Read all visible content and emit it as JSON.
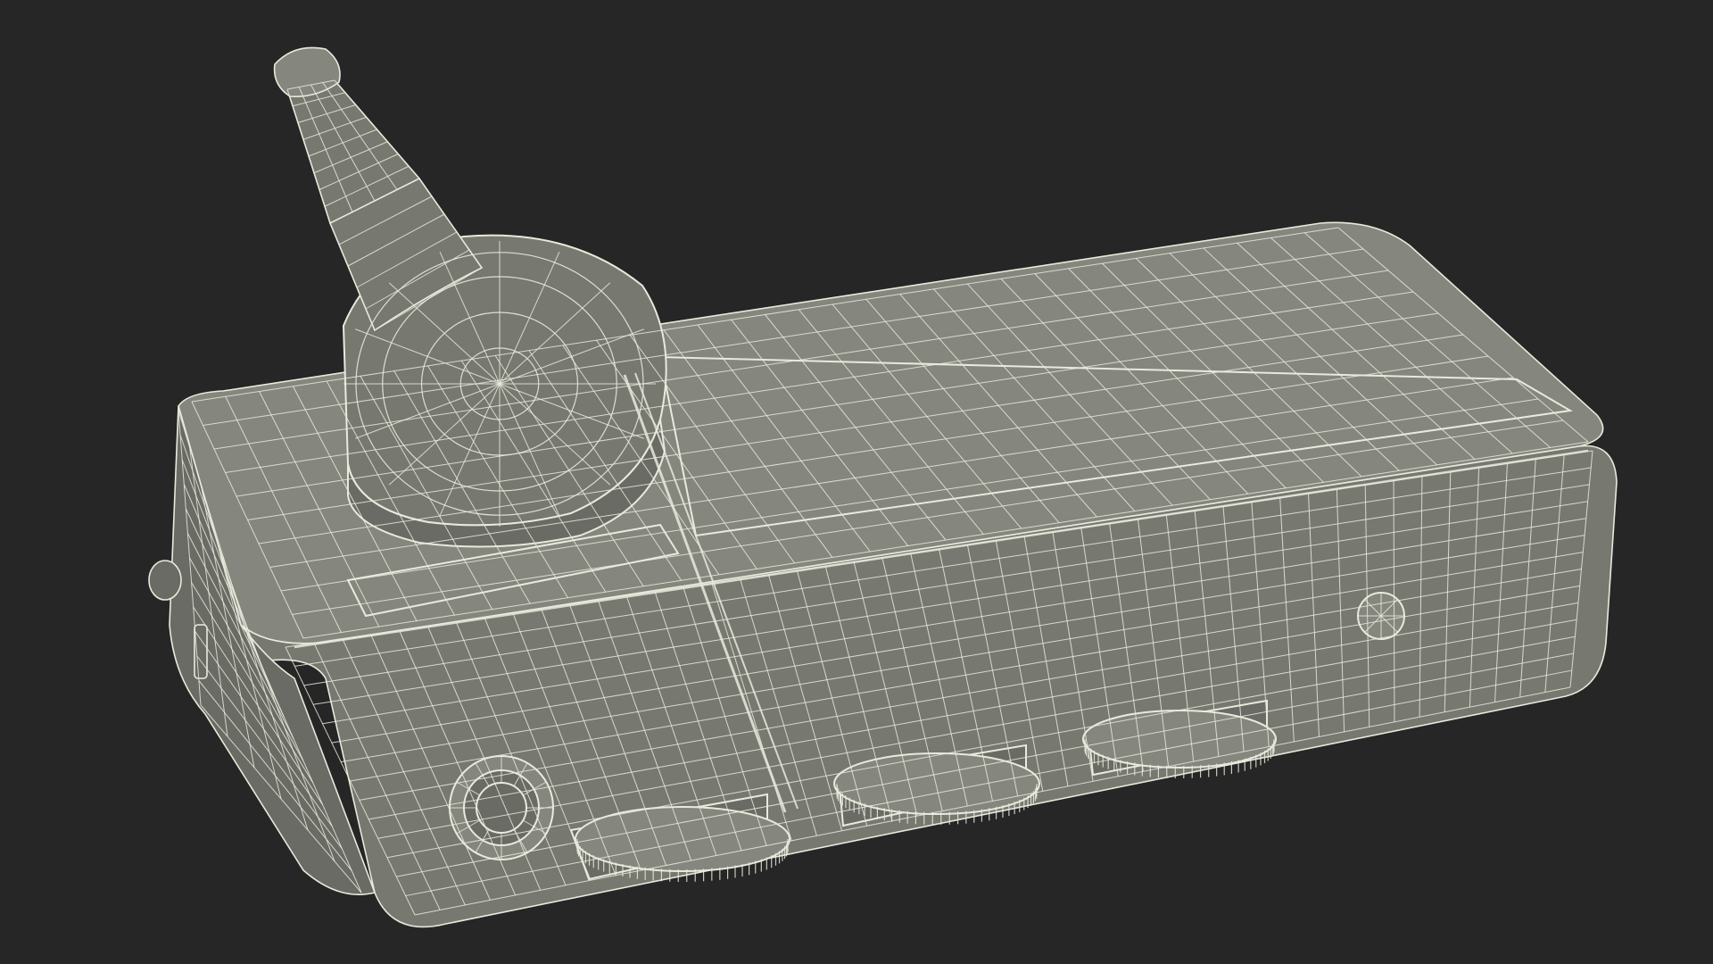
{
  "scene": {
    "background_color": "#262626",
    "surface_color": "#777870",
    "surface_dark_color": "#6a6b64",
    "surface_light_color": "#85867e",
    "wire_color": "#e9e9dc",
    "wire_dim_color": "#c9c9bc"
  },
  "objects": [
    "device-body-mesh",
    "antenna-base-mesh",
    "antenna-mast-mesh",
    "jack-port-mesh",
    "dial-knob-1-mesh",
    "dial-knob-2-mesh",
    "dial-knob-3-mesh",
    "side-screw-mesh",
    "slider-switch-mesh"
  ]
}
